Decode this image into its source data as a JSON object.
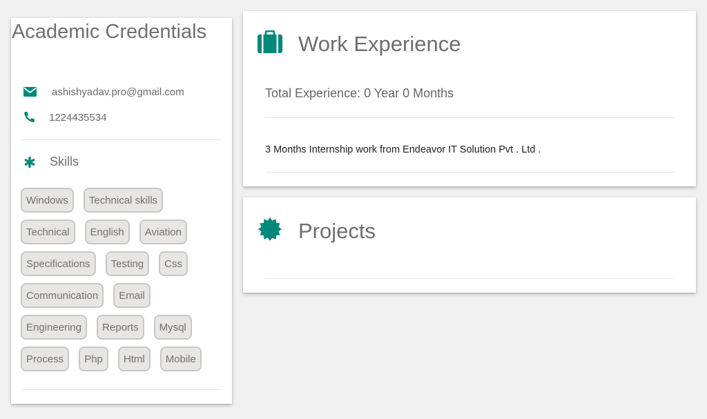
{
  "left": {
    "title": "Academic Credentials",
    "email": "ashishyadav.pro@gmail.com",
    "phone": "1224435534",
    "skills_label": "Skills",
    "skills": [
      "Windows",
      "Technical skills",
      "Technical",
      "English",
      "Aviation",
      "Specifications",
      "Testing",
      "Css",
      "Communication",
      "Email",
      "Engineering",
      "Reports",
      "Mysql",
      "Process",
      "Php",
      "Html",
      "Mobile"
    ]
  },
  "work": {
    "title": "Work Experience",
    "total": "Total Experience: 0 Year 0 Months",
    "items": [
      "3 Months Internship work from Endeavor IT Solution Pvt . Ltd ."
    ]
  },
  "projects": {
    "title": "Projects"
  },
  "icons": {
    "email": "envelope-icon",
    "phone": "phone-icon",
    "skills": "asterisk-icon",
    "work": "briefcase-icon",
    "projects": "badge-icon"
  },
  "colors": {
    "accent": "#00897b",
    "background": "#f0f0f0",
    "card": "#ffffff",
    "chip_bg": "#e8e5e5",
    "chip_border": "#c9c6c6"
  }
}
